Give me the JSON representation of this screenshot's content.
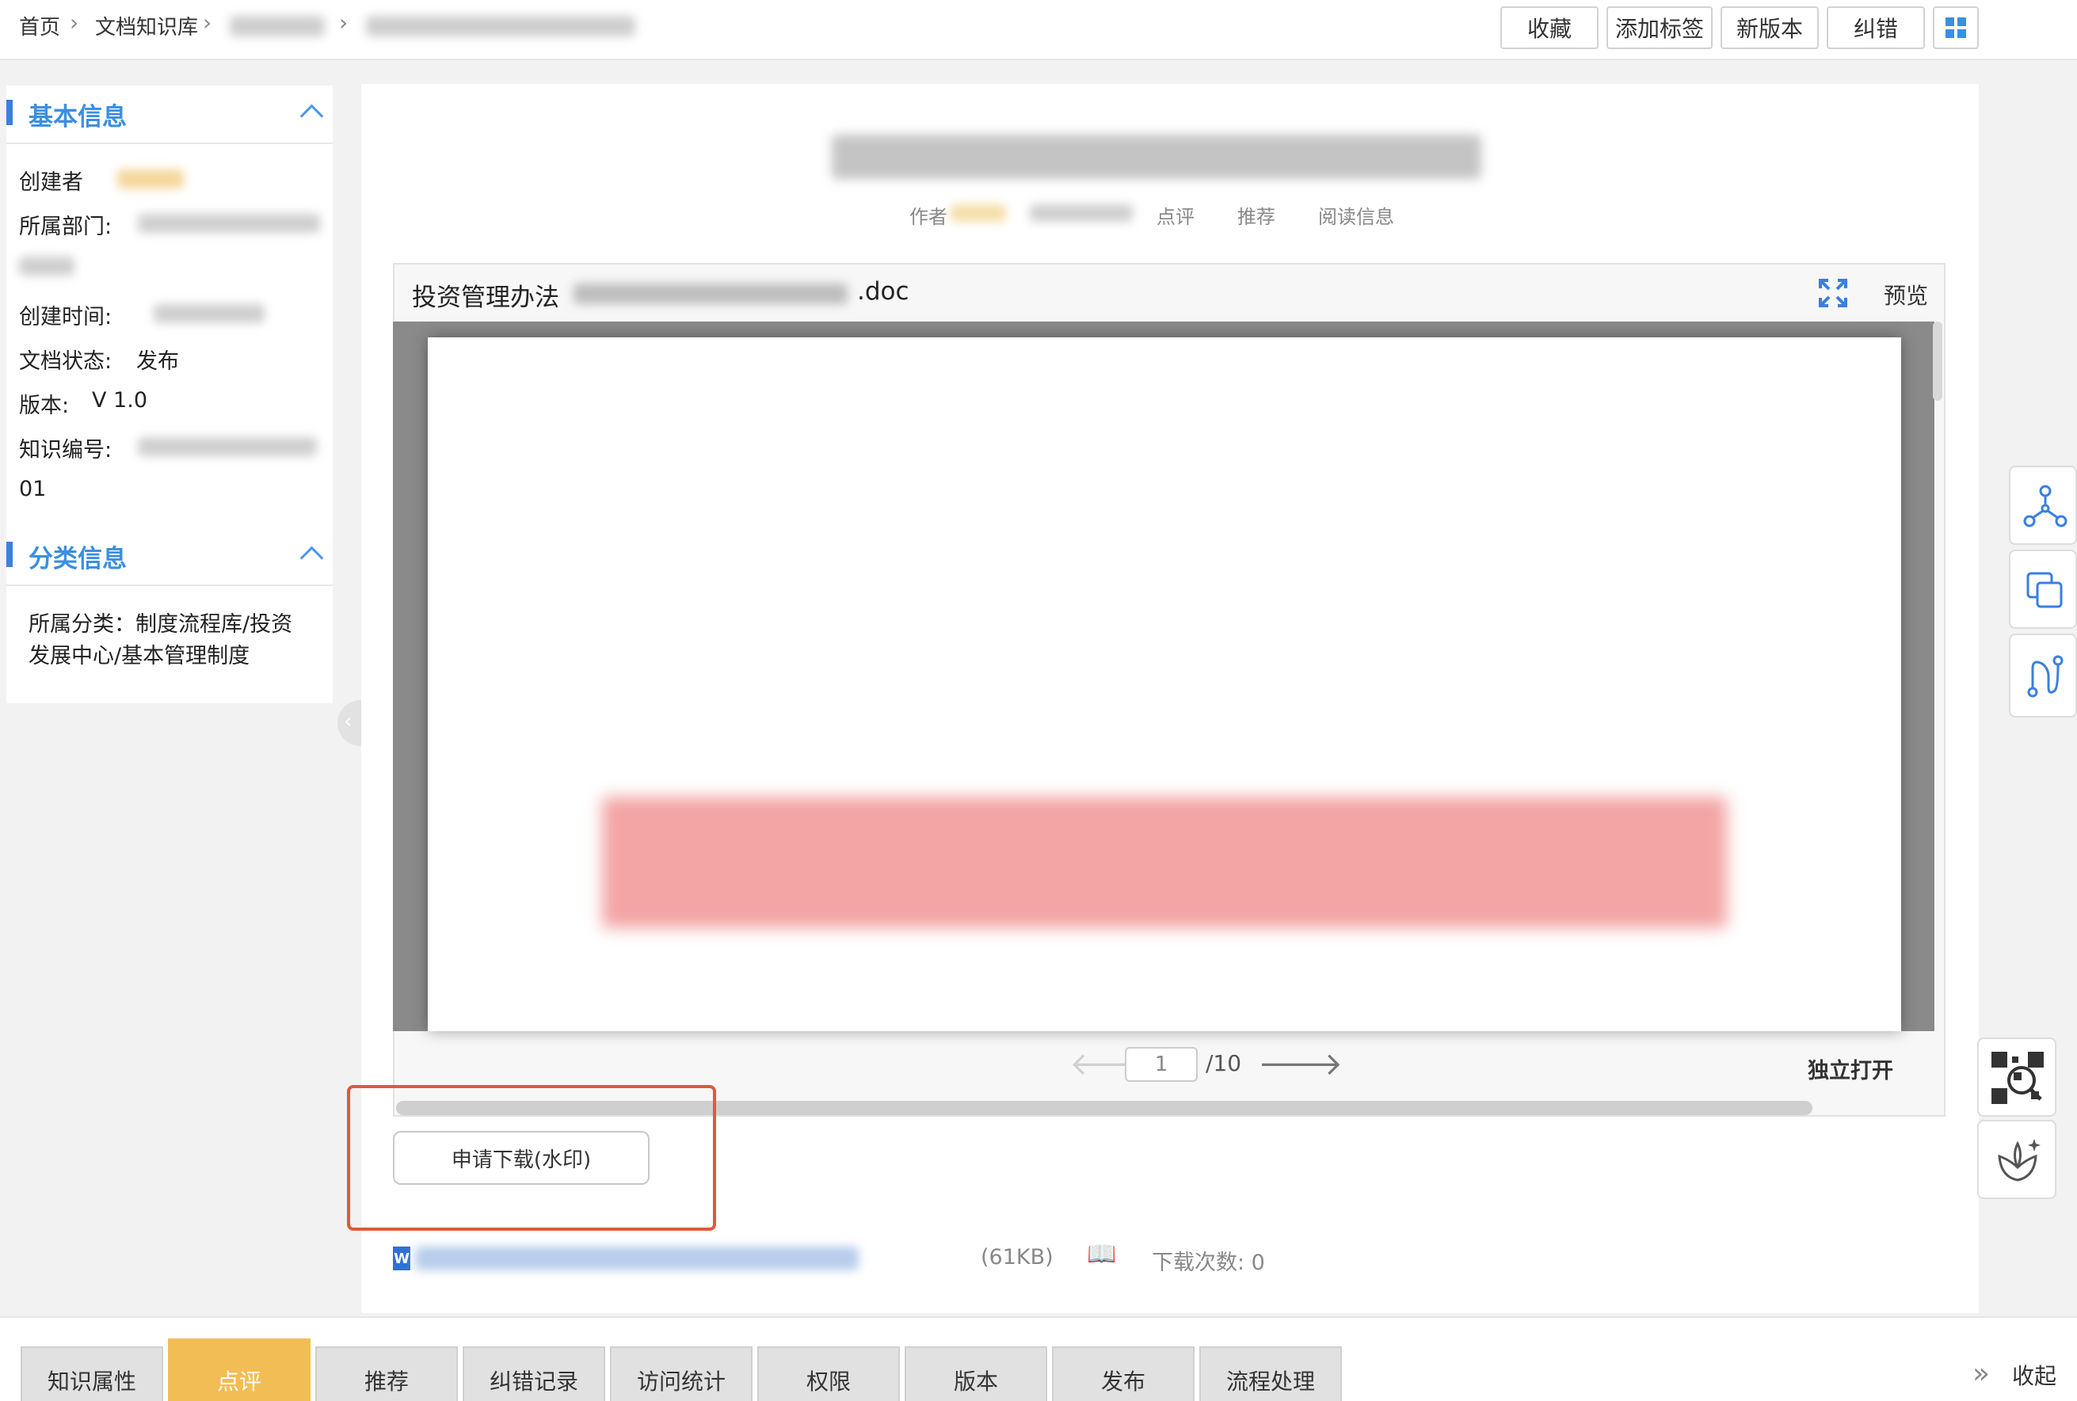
{
  "breadcrumb": {
    "home": "首页",
    "library": "文档知识库"
  },
  "toolbar": {
    "favorite": "收藏",
    "add_tag": "添加标签",
    "new_version": "新版本",
    "correct": "纠错"
  },
  "basic_info": {
    "title": "基本信息",
    "creator_label": "创建者",
    "dept_label": "所属部门:",
    "created_label": "创建时间:",
    "status_label": "文档状态:",
    "status_value": "发布",
    "version_label": "版本:",
    "version_value": "V 1.0",
    "number_label": "知识编号:",
    "number_tail": "01"
  },
  "category_info": {
    "title": "分类信息",
    "line1": "所属分类：制度流程库/投资",
    "line2": "发展中心/基本管理制度"
  },
  "doc_meta": {
    "author": "作者",
    "comments": "点评",
    "recommend": "推荐",
    "read_info": "阅读信息"
  },
  "viewer": {
    "file_prefix": "投资管理办法",
    "file_suffix": ".doc",
    "preview": "预览",
    "page_current": "1",
    "page_total": "/10",
    "open_standalone": "独立打开"
  },
  "download": {
    "button": "申请下载(水印)"
  },
  "attachment": {
    "size": "(61KB)",
    "downloads": "下载次数: 0"
  },
  "tabs": [
    "知识属性",
    "点评",
    "推荐",
    "纠错记录",
    "访问统计",
    "权限",
    "版本",
    "发布",
    "流程处理"
  ],
  "collapse": "收起",
  "colors": {
    "accent": "#3a8fe0",
    "active_tab": "#f2bd55",
    "highlight": "#e05a35"
  }
}
